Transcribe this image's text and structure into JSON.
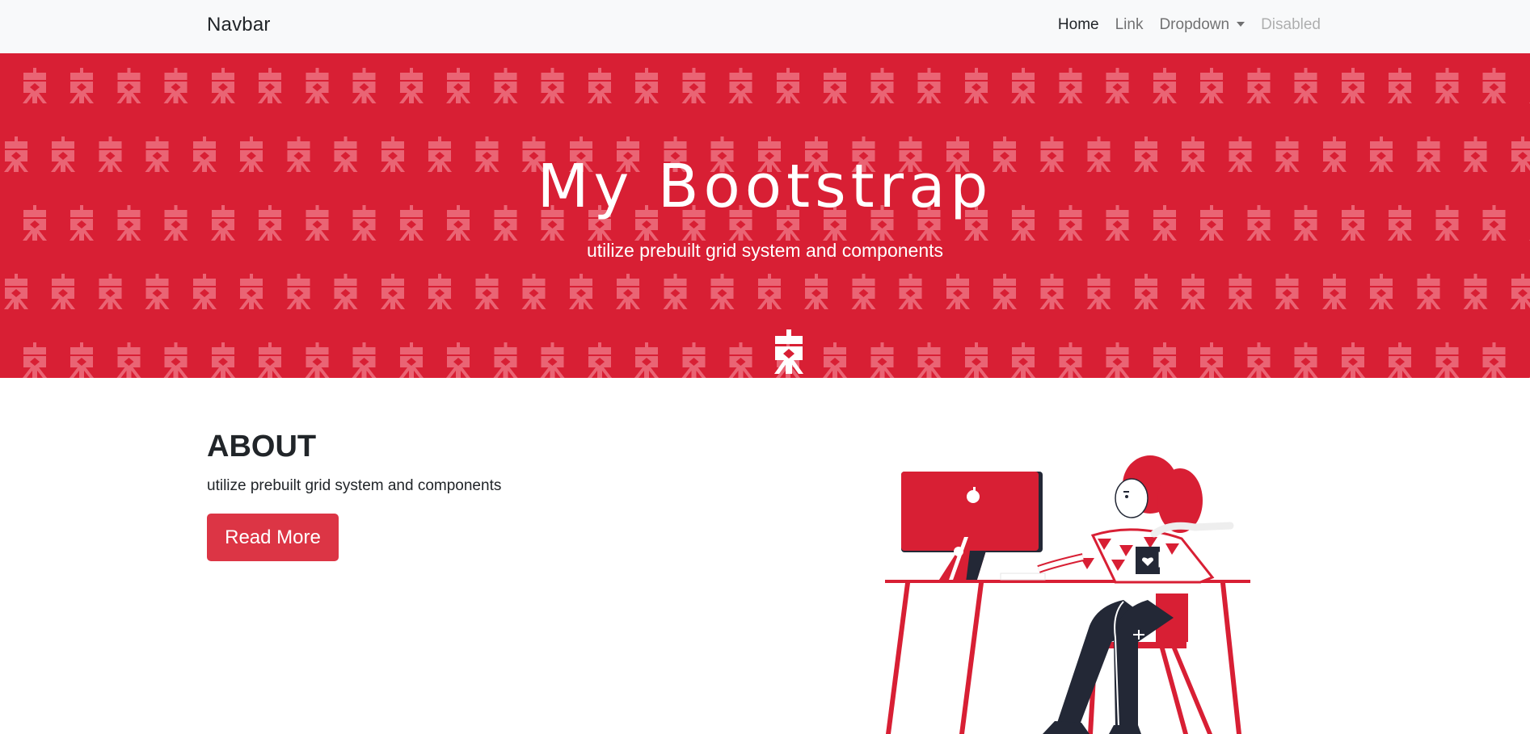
{
  "navbar": {
    "brand": "Navbar",
    "links": [
      {
        "label": "Home",
        "state": "active"
      },
      {
        "label": "Link",
        "state": "normal"
      },
      {
        "label": "Dropdown",
        "state": "dropdown"
      },
      {
        "label": "Disabled",
        "state": "disabled"
      }
    ]
  },
  "hero": {
    "title": "My Bootstrap",
    "subtitle": "utilize prebuilt grid system and components",
    "background_color": "#d81f34",
    "pattern_icon": "tripod-robot-icon",
    "logo_icon": "tripod-robot-icon"
  },
  "about": {
    "title": "ABOUT",
    "text": "utilize prebuilt grid system and components",
    "button_label": "Read More",
    "button_color": "#dc3545"
  },
  "illustration": {
    "description_icon": "woman-at-desk-illustration",
    "accent_color": "#d81f34",
    "dark_color": "#232836"
  }
}
